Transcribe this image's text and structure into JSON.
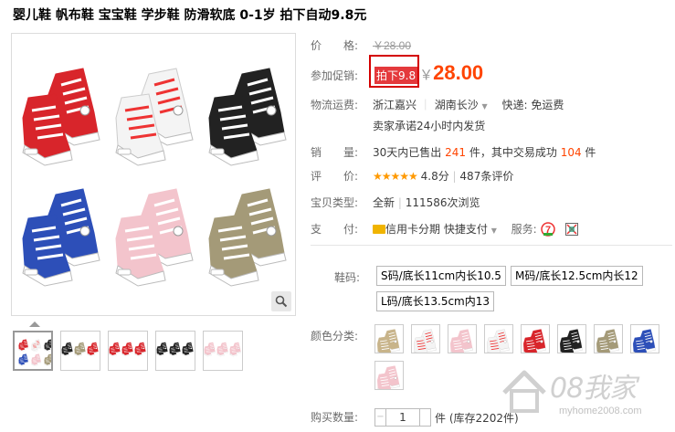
{
  "title": "婴儿鞋 帆布鞋 宝宝鞋 学步鞋 防滑软底 0-1岁 拍下自动9.8元",
  "price": {
    "label": "价　　格:",
    "original": "￥28.00"
  },
  "promo": {
    "label": "参加促销:",
    "tag": "拍下9.8",
    "yen": "￥",
    "price": "28.00"
  },
  "shipping": {
    "label": "物流运费:",
    "from": "浙江嘉兴",
    "sep": "｜",
    "to": "湖南长沙",
    "type": "快递: 免运费",
    "promise": "卖家承诺24小时内发货"
  },
  "sales": {
    "label": "销　　量:",
    "text_a": "30天内已售出",
    "sold": "241",
    "text_b": "件，其中交易成功",
    "success": "104",
    "text_c": "件"
  },
  "rating": {
    "label": "评　　价:",
    "stars": "★★★★★",
    "score": "4.8分",
    "sep": "|",
    "reviews": "487条评价"
  },
  "type": {
    "label": "宝贝类型:",
    "condition": "全新",
    "sep": "|",
    "views": "111586次浏览"
  },
  "payment": {
    "label": "支　　付:",
    "credit": "信用卡分期",
    "quick": "快捷支付",
    "service_label": "服务:"
  },
  "size": {
    "label": "鞋码:",
    "options": [
      "S码/底长11cm内长10.5",
      "M码/底长12.5cm内长12",
      "L码/底长13.5cm内13"
    ]
  },
  "color": {
    "label": "颜色分类:"
  },
  "quantity": {
    "label": "购买数量:",
    "value": "1",
    "stock": "件 (库存2202件)"
  },
  "watermark": {
    "text": "08我家",
    "url": "myhome2008.com"
  },
  "colors": {
    "accent": "#ff4400",
    "promo_red": "#e4393c",
    "star": "#ff9900"
  },
  "shoe_colors": [
    "#d8252b",
    "#f4f4f4",
    "#222222",
    "#2d4fb8",
    "#f3c4cc",
    "#a49a78"
  ]
}
